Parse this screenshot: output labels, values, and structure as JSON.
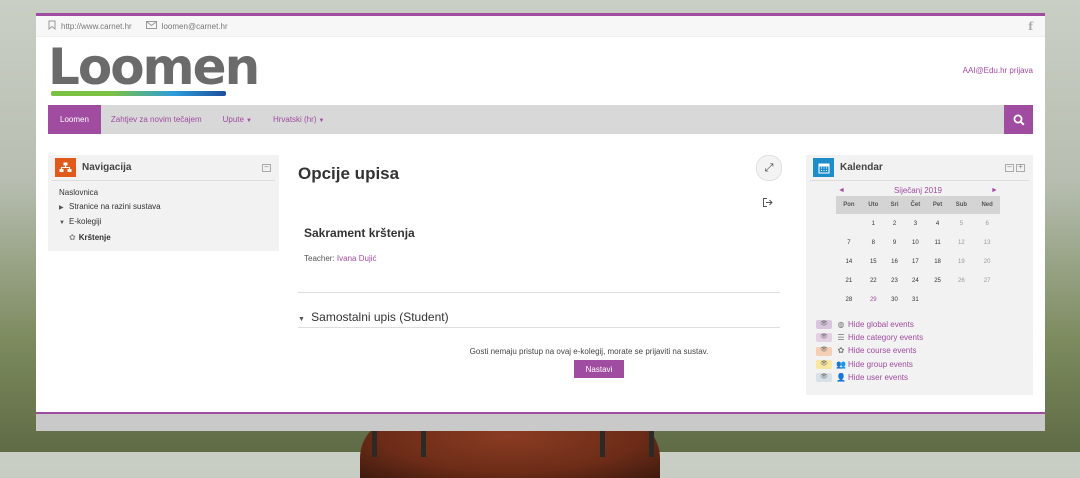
{
  "topbar": {
    "website": "http://www.carnet.hr",
    "email": "loomen@carnet.hr",
    "social_icon": "f"
  },
  "header": {
    "logo_text": "Loomen",
    "login_link": "AAI@Edu.hr prijava"
  },
  "navbar": {
    "brand": "Loomen",
    "links": [
      "Zahtjev za novim tečajem",
      "Upute",
      "Hrvatski (hr)"
    ]
  },
  "navigation": {
    "title": "Navigacija",
    "items": [
      "Naslovnica",
      "Stranice na razini sustava",
      "E-kolegiji",
      "Krštenje"
    ]
  },
  "main": {
    "title": "Opcije upisa",
    "course_title": "Sakrament krštenja",
    "teacher_label": "Teacher:",
    "teacher_name": "Ivana Dujić",
    "section_title": "Samostalni upis (Student)",
    "guest_message": "Gosti nemaju pristup na ovaj e-kolegij, morate se prijaviti na sustav.",
    "continue_button": "Nastavi"
  },
  "calendar": {
    "title": "Kalendar",
    "month": "Siječanj 2019",
    "prev": "◄",
    "next": "►",
    "weekdays": [
      "Pon",
      "Uto",
      "Sri",
      "Čet",
      "Pet",
      "Sub",
      "Ned"
    ],
    "weeks": [
      [
        "",
        "1",
        "2",
        "3",
        "4",
        "5",
        "6"
      ],
      [
        "7",
        "8",
        "9",
        "10",
        "11",
        "12",
        "13"
      ],
      [
        "14",
        "15",
        "16",
        "17",
        "18",
        "19",
        "20"
      ],
      [
        "21",
        "22",
        "23",
        "24",
        "25",
        "26",
        "27"
      ],
      [
        "28",
        "29",
        "30",
        "31",
        "",
        "",
        ""
      ]
    ],
    "event_links": [
      {
        "label": "Hide global events",
        "color": "#d9c6dd",
        "icon": "globe-icon"
      },
      {
        "label": "Hide category events",
        "color": "#e5d0e3",
        "icon": "category-icon"
      },
      {
        "label": "Hide course events",
        "color": "#f6cfb4",
        "icon": "course-icon"
      },
      {
        "label": "Hide group events",
        "color": "#f7e7a1",
        "icon": "group-icon"
      },
      {
        "label": "Hide user events",
        "color": "#d8e0e8",
        "icon": "user-icon"
      }
    ]
  }
}
